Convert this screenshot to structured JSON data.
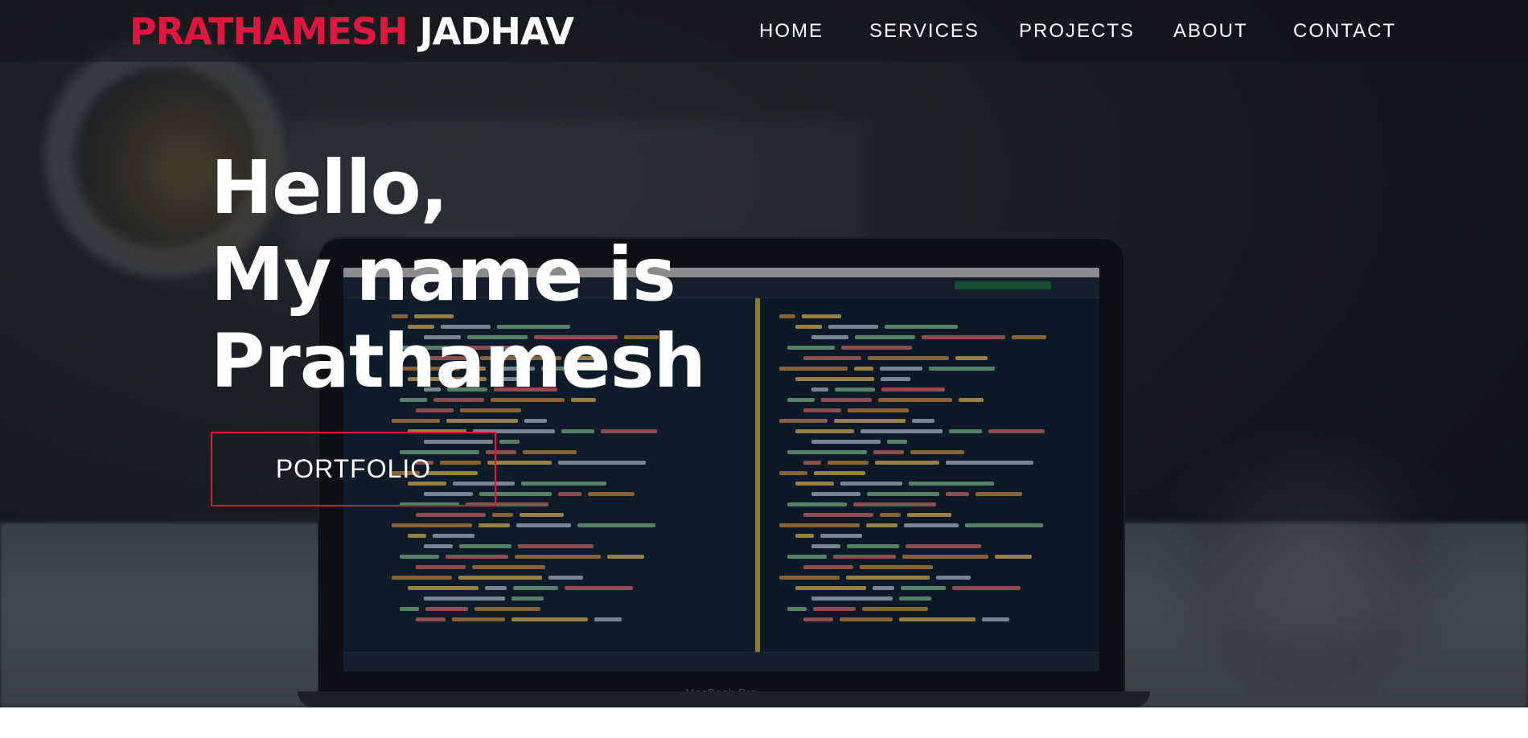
{
  "nav": {
    "brand_first": "PRATHAMESH",
    "brand_last": "JADHAV",
    "links": [
      {
        "label": "HOME"
      },
      {
        "label": "SERVICES"
      },
      {
        "label": "PROJECTS"
      },
      {
        "label": "ABOUT"
      },
      {
        "label": "CONTACT"
      }
    ]
  },
  "hero": {
    "line1": "Hello,",
    "line2": "My name is",
    "line3": "Prathamesh",
    "button_label": "PORTFOLIO",
    "laptop_brand": "MacBook Pro"
  },
  "colors": {
    "accent": "#e0163e",
    "text": "#ffffff",
    "nav_bg": "#121418"
  }
}
